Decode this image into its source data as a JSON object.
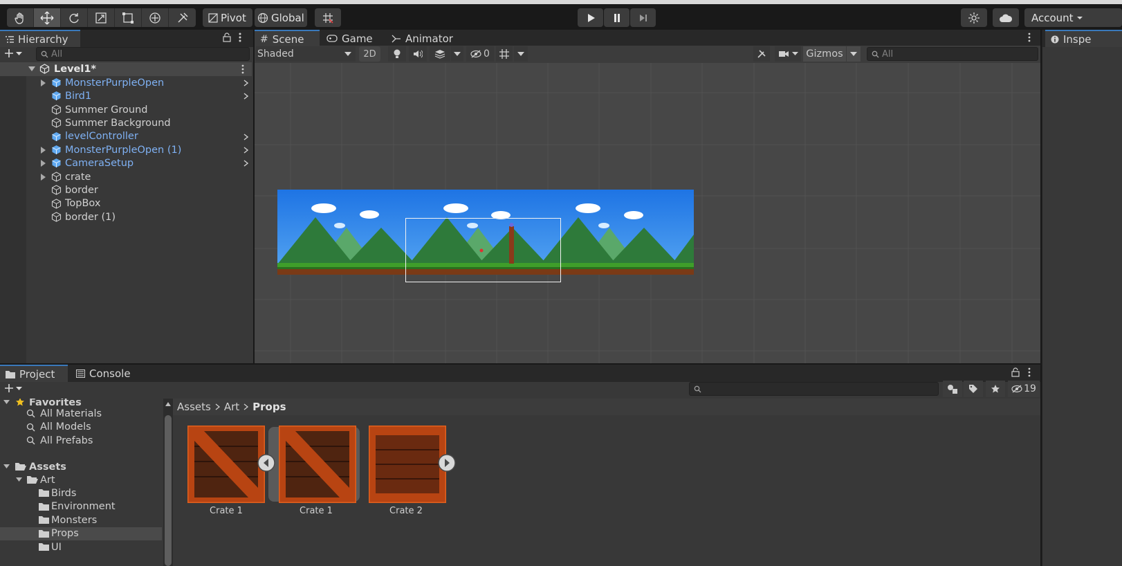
{
  "toolbar": {
    "tools": [
      "hand-tool",
      "move-tool",
      "rotate-tool",
      "scale-tool",
      "rect-tool",
      "transform-tool",
      "custom-tool"
    ],
    "pivot_label": "Pivot",
    "global_label": "Global",
    "account_label": "Account"
  },
  "hierarchy": {
    "tab_label": "Hierarchy",
    "search_placeholder": "All",
    "scene_name": "Level1*",
    "items": [
      {
        "name": "MonsterPurpleOpen",
        "prefab": true,
        "expandable": true
      },
      {
        "name": "Bird1",
        "prefab": true,
        "expandable": false
      },
      {
        "name": "Summer Ground",
        "prefab": false,
        "expandable": false
      },
      {
        "name": "Summer Background",
        "prefab": false,
        "expandable": false
      },
      {
        "name": "levelController",
        "prefab": true,
        "expandable": false
      },
      {
        "name": "MonsterPurpleOpen (1)",
        "prefab": true,
        "expandable": true
      },
      {
        "name": "CameraSetup",
        "prefab": true,
        "expandable": true
      },
      {
        "name": "crate",
        "prefab": false,
        "expandable": true
      },
      {
        "name": "border",
        "prefab": false,
        "expandable": false
      },
      {
        "name": "TopBox",
        "prefab": false,
        "expandable": false
      },
      {
        "name": "border (1)",
        "prefab": false,
        "expandable": false
      }
    ]
  },
  "scene": {
    "tabs": [
      "Scene",
      "Game",
      "Animator"
    ],
    "shading_mode": "Shaded",
    "mode_2d": "2D",
    "hidden_count": "0",
    "gizmos_label": "Gizmos",
    "search_placeholder": "All"
  },
  "inspector": {
    "tab_label": "Inspe"
  },
  "project": {
    "tabs": [
      "Project",
      "Console"
    ],
    "hidden_count": "19",
    "breadcrumb": [
      "Assets",
      "Art",
      "Props"
    ],
    "favorites_label": "Favorites",
    "favorites": [
      "All Materials",
      "All Models",
      "All Prefabs"
    ],
    "assets_label": "Assets",
    "art_label": "Art",
    "art_children": [
      "Birds",
      "Environment",
      "Monsters",
      "Props",
      "UI"
    ],
    "assets_grid": [
      "Crate 1",
      "Crate 1",
      "Crate 2"
    ]
  }
}
